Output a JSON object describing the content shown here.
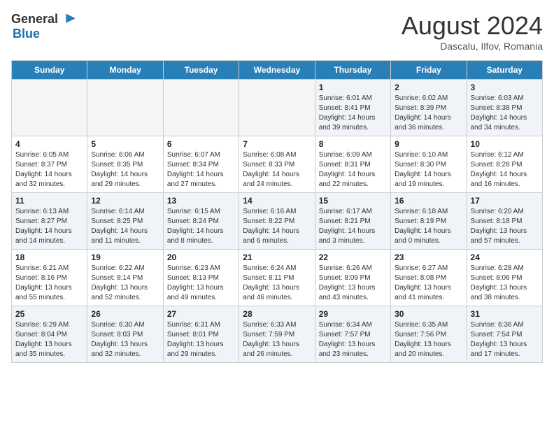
{
  "header": {
    "logo_general": "General",
    "logo_blue": "Blue",
    "month_title": "August 2024",
    "subtitle": "Dascalu, Ilfov, Romania"
  },
  "weekdays": [
    "Sunday",
    "Monday",
    "Tuesday",
    "Wednesday",
    "Thursday",
    "Friday",
    "Saturday"
  ],
  "weeks": [
    [
      {
        "day": "",
        "info": ""
      },
      {
        "day": "",
        "info": ""
      },
      {
        "day": "",
        "info": ""
      },
      {
        "day": "",
        "info": ""
      },
      {
        "day": "1",
        "info": "Sunrise: 6:01 AM\nSunset: 8:41 PM\nDaylight: 14 hours and 39 minutes."
      },
      {
        "day": "2",
        "info": "Sunrise: 6:02 AM\nSunset: 8:39 PM\nDaylight: 14 hours and 36 minutes."
      },
      {
        "day": "3",
        "info": "Sunrise: 6:03 AM\nSunset: 8:38 PM\nDaylight: 14 hours and 34 minutes."
      }
    ],
    [
      {
        "day": "4",
        "info": "Sunrise: 6:05 AM\nSunset: 8:37 PM\nDaylight: 14 hours and 32 minutes."
      },
      {
        "day": "5",
        "info": "Sunrise: 6:06 AM\nSunset: 8:35 PM\nDaylight: 14 hours and 29 minutes."
      },
      {
        "day": "6",
        "info": "Sunrise: 6:07 AM\nSunset: 8:34 PM\nDaylight: 14 hours and 27 minutes."
      },
      {
        "day": "7",
        "info": "Sunrise: 6:08 AM\nSunset: 8:33 PM\nDaylight: 14 hours and 24 minutes."
      },
      {
        "day": "8",
        "info": "Sunrise: 6:09 AM\nSunset: 8:31 PM\nDaylight: 14 hours and 22 minutes."
      },
      {
        "day": "9",
        "info": "Sunrise: 6:10 AM\nSunset: 8:30 PM\nDaylight: 14 hours and 19 minutes."
      },
      {
        "day": "10",
        "info": "Sunrise: 6:12 AM\nSunset: 8:28 PM\nDaylight: 14 hours and 16 minutes."
      }
    ],
    [
      {
        "day": "11",
        "info": "Sunrise: 6:13 AM\nSunset: 8:27 PM\nDaylight: 14 hours and 14 minutes."
      },
      {
        "day": "12",
        "info": "Sunrise: 6:14 AM\nSunset: 8:25 PM\nDaylight: 14 hours and 11 minutes."
      },
      {
        "day": "13",
        "info": "Sunrise: 6:15 AM\nSunset: 8:24 PM\nDaylight: 14 hours and 8 minutes."
      },
      {
        "day": "14",
        "info": "Sunrise: 6:16 AM\nSunset: 8:22 PM\nDaylight: 14 hours and 6 minutes."
      },
      {
        "day": "15",
        "info": "Sunrise: 6:17 AM\nSunset: 8:21 PM\nDaylight: 14 hours and 3 minutes."
      },
      {
        "day": "16",
        "info": "Sunrise: 6:18 AM\nSunset: 8:19 PM\nDaylight: 14 hours and 0 minutes."
      },
      {
        "day": "17",
        "info": "Sunrise: 6:20 AM\nSunset: 8:18 PM\nDaylight: 13 hours and 57 minutes."
      }
    ],
    [
      {
        "day": "18",
        "info": "Sunrise: 6:21 AM\nSunset: 8:16 PM\nDaylight: 13 hours and 55 minutes."
      },
      {
        "day": "19",
        "info": "Sunrise: 6:22 AM\nSunset: 8:14 PM\nDaylight: 13 hours and 52 minutes."
      },
      {
        "day": "20",
        "info": "Sunrise: 6:23 AM\nSunset: 8:13 PM\nDaylight: 13 hours and 49 minutes."
      },
      {
        "day": "21",
        "info": "Sunrise: 6:24 AM\nSunset: 8:11 PM\nDaylight: 13 hours and 46 minutes."
      },
      {
        "day": "22",
        "info": "Sunrise: 6:26 AM\nSunset: 8:09 PM\nDaylight: 13 hours and 43 minutes."
      },
      {
        "day": "23",
        "info": "Sunrise: 6:27 AM\nSunset: 8:08 PM\nDaylight: 13 hours and 41 minutes."
      },
      {
        "day": "24",
        "info": "Sunrise: 6:28 AM\nSunset: 8:06 PM\nDaylight: 13 hours and 38 minutes."
      }
    ],
    [
      {
        "day": "25",
        "info": "Sunrise: 6:29 AM\nSunset: 8:04 PM\nDaylight: 13 hours and 35 minutes."
      },
      {
        "day": "26",
        "info": "Sunrise: 6:30 AM\nSunset: 8:03 PM\nDaylight: 13 hours and 32 minutes."
      },
      {
        "day": "27",
        "info": "Sunrise: 6:31 AM\nSunset: 8:01 PM\nDaylight: 13 hours and 29 minutes."
      },
      {
        "day": "28",
        "info": "Sunrise: 6:33 AM\nSunset: 7:59 PM\nDaylight: 13 hours and 26 minutes."
      },
      {
        "day": "29",
        "info": "Sunrise: 6:34 AM\nSunset: 7:57 PM\nDaylight: 13 hours and 23 minutes."
      },
      {
        "day": "30",
        "info": "Sunrise: 6:35 AM\nSunset: 7:56 PM\nDaylight: 13 hours and 20 minutes."
      },
      {
        "day": "31",
        "info": "Sunrise: 6:36 AM\nSunset: 7:54 PM\nDaylight: 13 hours and 17 minutes."
      }
    ]
  ]
}
